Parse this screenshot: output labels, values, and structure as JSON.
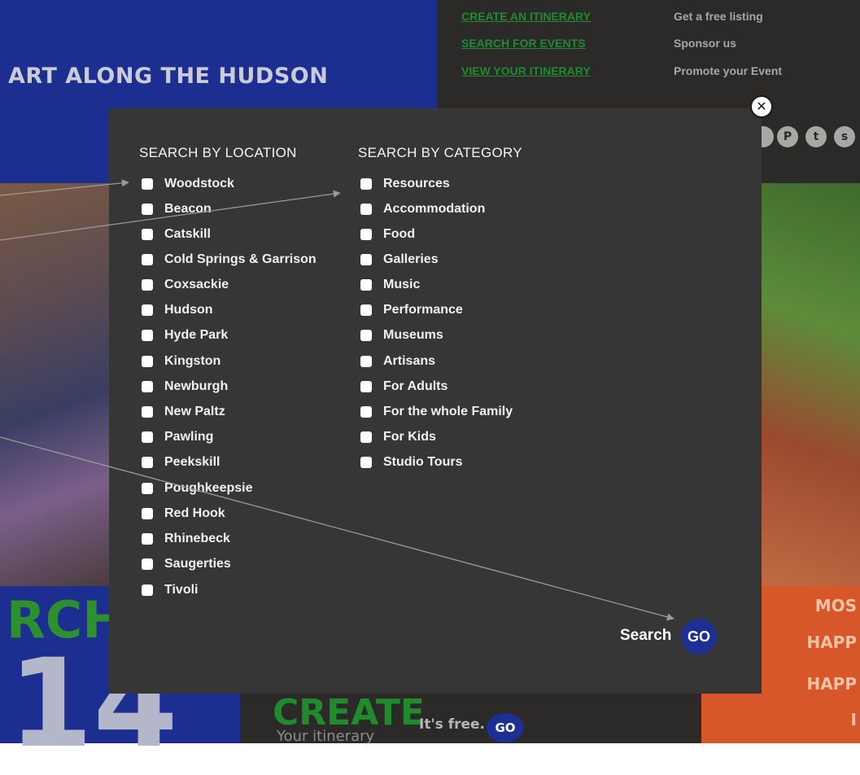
{
  "header": {
    "title": "ART ALONG THE HUDSON",
    "links_left": [
      "CREATE AN ITINERARY",
      "SEARCH FOR EVENTS",
      "VIEW YOUR ITINERARY"
    ],
    "links_right": [
      "Get a free listing",
      "Sponsor us",
      "Promote your Event"
    ],
    "social_icons": [
      "pinterest-icon",
      "twitter-icon",
      "stumbleupon-icon"
    ]
  },
  "modal": {
    "close_icon": "close-circle-icon",
    "location_heading": "SEARCH BY LOCATION",
    "category_heading": "SEARCH BY CATEGORY",
    "locations": [
      "Woodstock",
      "Beacon",
      "Catskill",
      "Cold Springs & Garrison",
      "Coxsackie",
      "Hudson",
      "Hyde Park",
      "Kingston",
      "Newburgh",
      "New Paltz",
      "Pawling",
      "Peekskill",
      "Poughkeepsie",
      "Red Hook",
      "Rhinebeck",
      "Saugerties",
      "Tivoli"
    ],
    "categories": [
      "Resources",
      "Accommodation",
      "Food",
      "Galleries",
      "Music",
      "Performance",
      "Museums",
      "Artisans",
      "For Adults",
      "For the whole Family",
      "For Kids",
      "Studio Tours"
    ],
    "search_label": "Search",
    "go_label": "GO"
  },
  "background": {
    "rch": "RCH",
    "year_digits": "14",
    "create_big": "CREATE",
    "create_sub": "Your itinerary",
    "free_text": "It's free.",
    "go_small": "GO",
    "right_lines": [
      "MOS",
      "HAPP",
      "HAPP",
      "I"
    ]
  },
  "colors": {
    "brand_blue": "#1c2e8f",
    "link_green": "#1f8b2d",
    "modal_bg": "#363636",
    "orange": "#d7562a"
  }
}
